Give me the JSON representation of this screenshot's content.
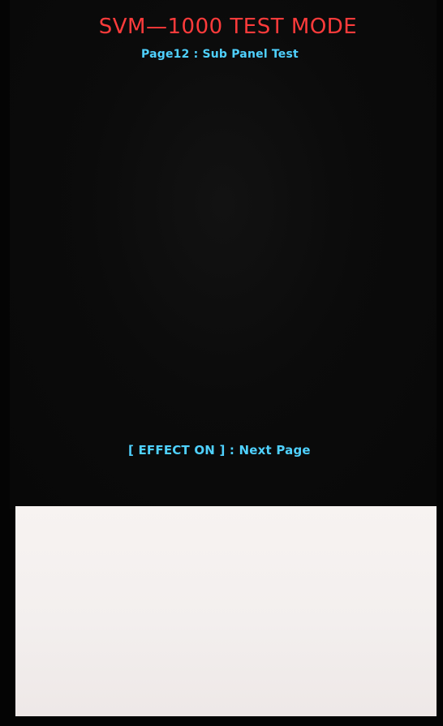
{
  "screen": {
    "title": "SVM—1000 TEST MODE",
    "subtitle": "Page12 : Sub Panel Test",
    "instruction": "[ EFFECT ON ] : Next Page"
  },
  "colors": {
    "title": "#ff3b3b",
    "text": "#4fd1ff",
    "background": "#0b0b0b",
    "sub_panel": "#f3efee"
  }
}
